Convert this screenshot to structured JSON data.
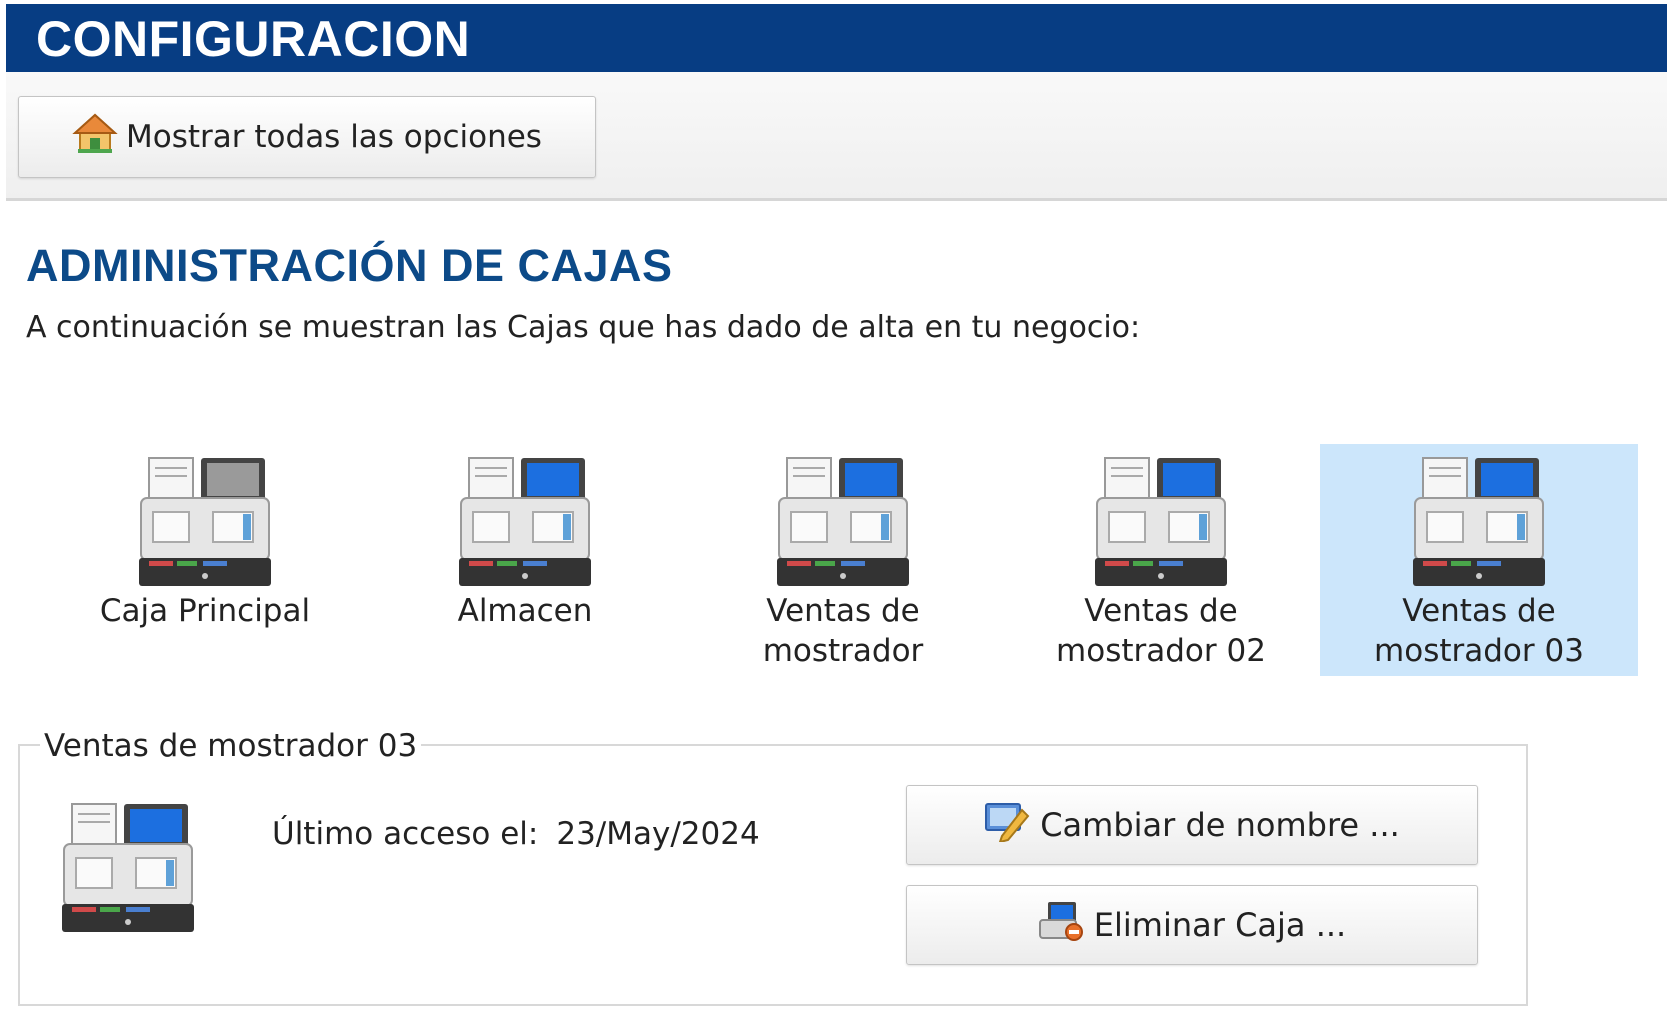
{
  "header": {
    "title": "CONFIGURACION"
  },
  "toolbar": {
    "show_all_label": "Mostrar todas las opciones",
    "icon": "home-icon"
  },
  "section": {
    "title": "ADMINISTRACIÓN DE CAJAS",
    "description": "A continuación se muestran las Cajas que has dado de alta en tu negocio:"
  },
  "cajas": [
    {
      "line1": "Caja Principal",
      "line2": "",
      "screen": "gray",
      "selected": false
    },
    {
      "line1": "Almacen",
      "line2": "",
      "screen": "blue",
      "selected": false
    },
    {
      "line1": "Ventas de",
      "line2": "mostrador",
      "screen": "blue",
      "selected": false
    },
    {
      "line1": "Ventas de",
      "line2": "mostrador 02",
      "screen": "blue",
      "selected": false
    },
    {
      "line1": "Ventas de",
      "line2": "mostrador 03",
      "screen": "blue",
      "selected": true
    }
  ],
  "detail": {
    "legend": "Ventas de mostrador 03",
    "last_access_label": "Último acceso el:",
    "last_access_value": "23/May/2024",
    "rename_label": "Cambiar de nombre ...",
    "delete_label": "Eliminar Caja ..."
  },
  "colors": {
    "header_bg": "#073d83",
    "title_blue": "#0c4a88",
    "selected_bg": "#cce6fb"
  }
}
